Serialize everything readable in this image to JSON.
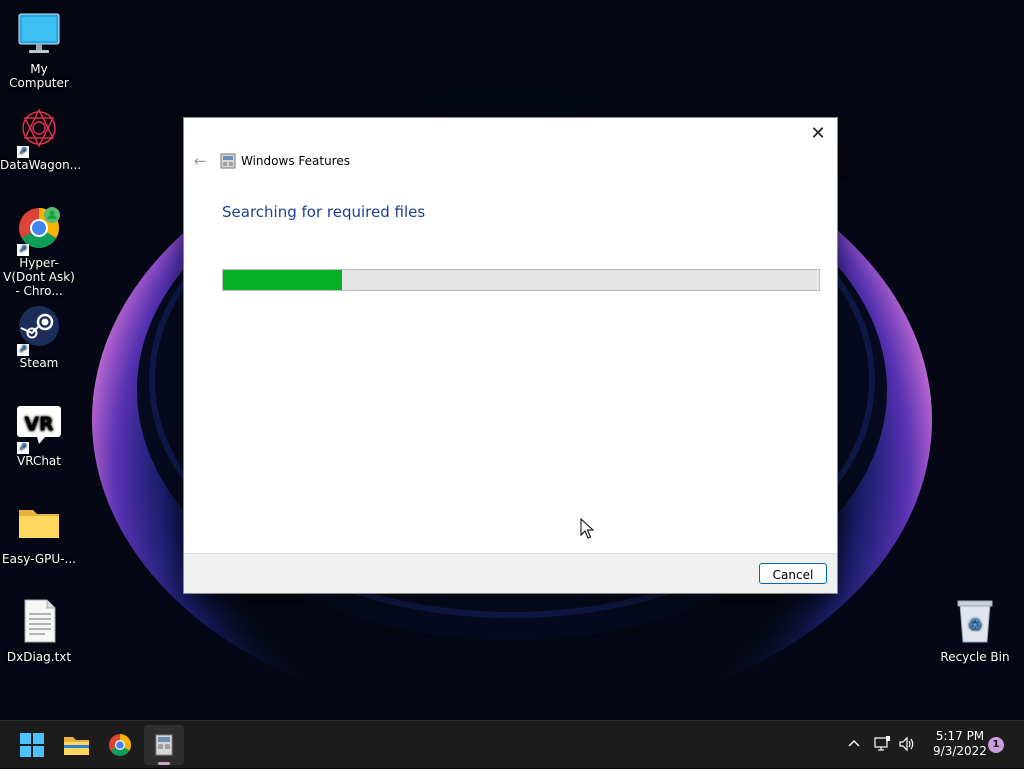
{
  "desktop": {
    "icons": [
      {
        "label": "My Computer",
        "icon": "monitor-icon"
      },
      {
        "label": "DataWagon...",
        "icon": "datawagon-icon"
      },
      {
        "label": "Hyper-V(Dont Ask) - Chro...",
        "icon": "chrome-icon"
      },
      {
        "label": "Steam",
        "icon": "steam-icon"
      },
      {
        "label": "VRChat",
        "icon": "vrchat-icon"
      },
      {
        "label": "Easy-GPU-...",
        "icon": "folder-icon"
      },
      {
        "label": "DxDiag.txt",
        "icon": "text-file-icon"
      },
      {
        "label": "Recycle Bin",
        "icon": "recycle-bin-icon"
      }
    ]
  },
  "dialog": {
    "title": "Windows Features",
    "heading": "Searching for required files",
    "progress": 0.2,
    "cancel_label": "Cancel",
    "close_glyph": "✕",
    "back_glyph": "←",
    "accent_color": "#06b025",
    "heading_color": "#1c3f94"
  },
  "taskbar": {
    "apps": [
      "start-icon",
      "file-explorer-icon",
      "chrome-icon",
      "windows-features-icon"
    ],
    "time": "5:17 PM",
    "date": "9/3/2022",
    "notification_count": "1"
  }
}
